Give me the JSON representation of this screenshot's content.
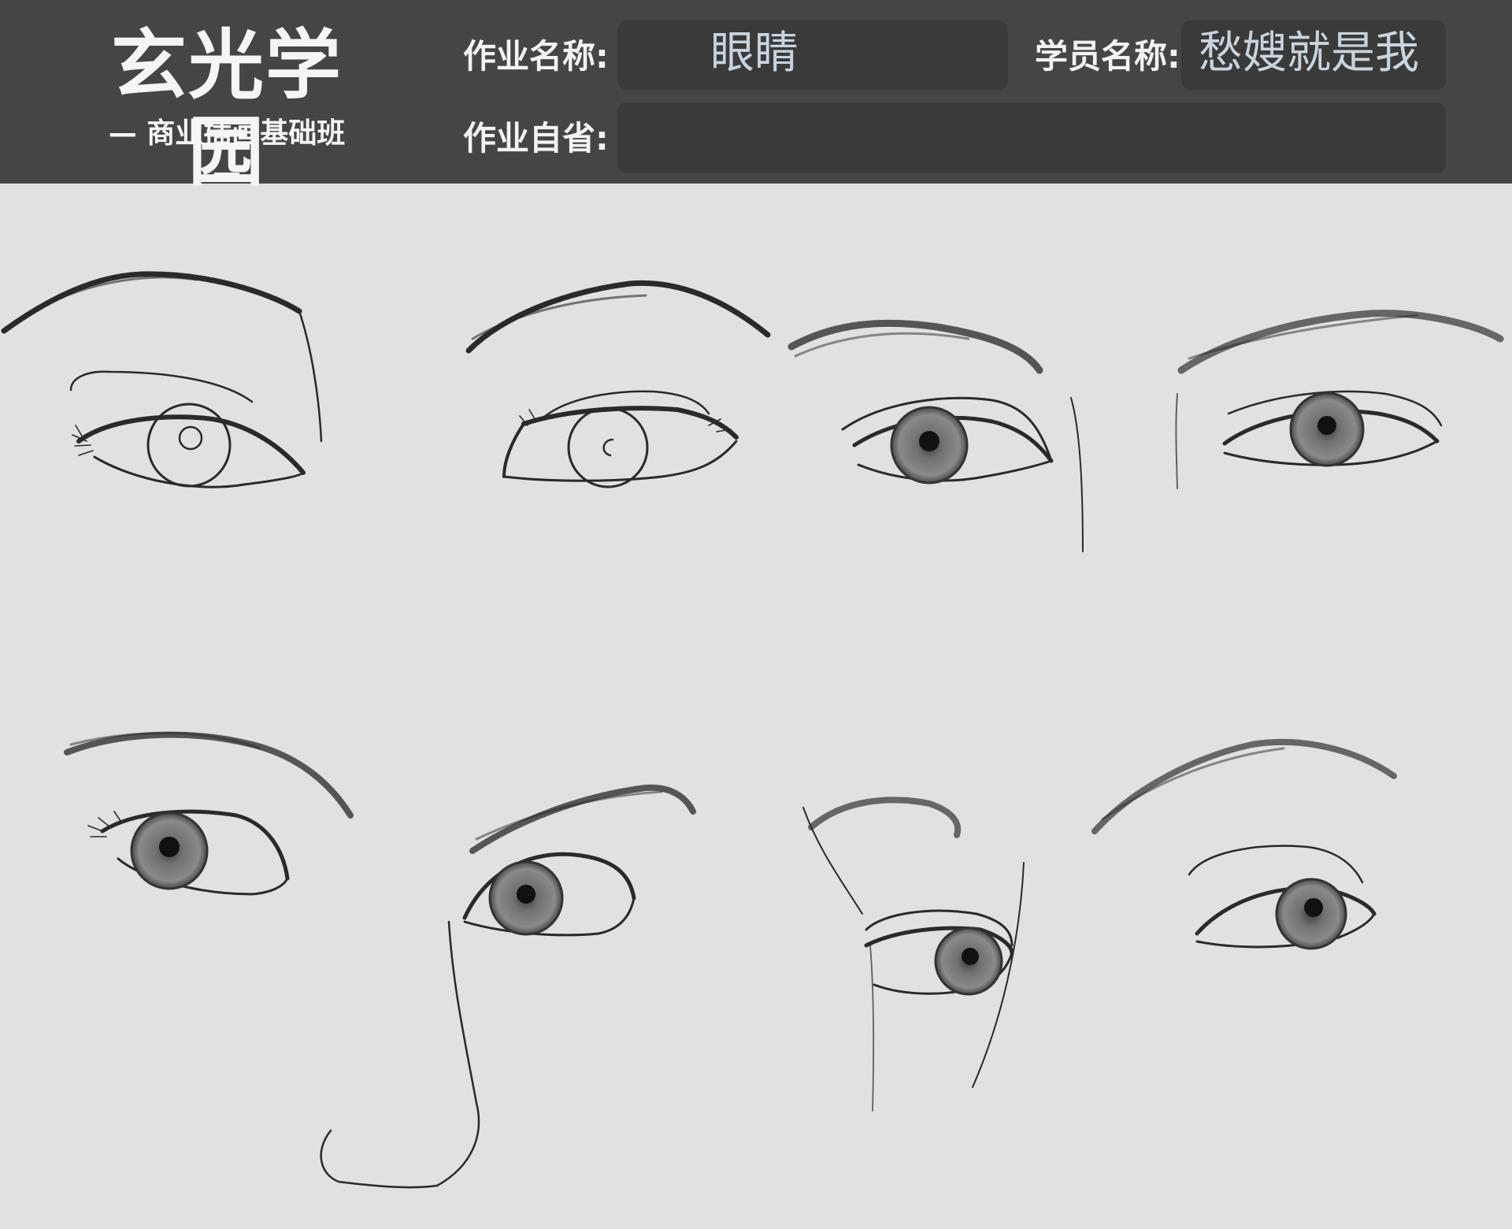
{
  "header": {
    "logo_title": "玄光学园",
    "logo_subtitle": "— 商业插画基础班 —",
    "assignment_name_label": "作业名称:",
    "assignment_name_value": "眼睛",
    "student_name_label": "学员名称:",
    "student_name_value": "愁嫂就是我",
    "reflection_label": "作业自省:",
    "reflection_value": ""
  },
  "drawings": [
    {
      "name": "eye-sketch-1",
      "style": "outline"
    },
    {
      "name": "eye-sketch-2",
      "style": "outline"
    },
    {
      "name": "eye-sketch-3",
      "style": "shaded"
    },
    {
      "name": "eye-sketch-4",
      "style": "shaded"
    },
    {
      "name": "eye-sketch-5",
      "style": "shaded"
    },
    {
      "name": "eye-sketch-6",
      "style": "shaded"
    },
    {
      "name": "eye-sketch-7",
      "style": "shaded"
    },
    {
      "name": "eye-sketch-8",
      "style": "shaded"
    }
  ],
  "colors": {
    "header_bg": "#454545",
    "field_bg": "#3a3a3a",
    "canvas_bg": "#e1e1e1",
    "value_text": "#c9d4df"
  }
}
